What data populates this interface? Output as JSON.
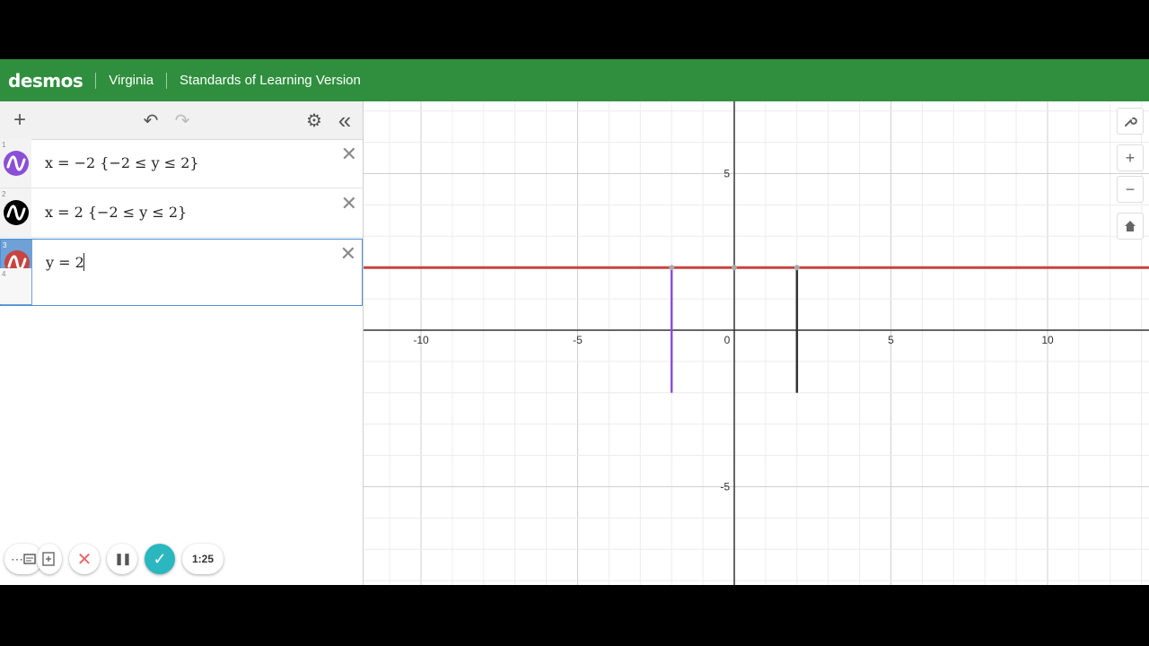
{
  "topbar": {
    "logo": "desmos",
    "region": "Virginia",
    "version": "Standards of Learning Version"
  },
  "toolbar": {
    "add_glyph": "+",
    "undo_glyph": "↶",
    "redo_glyph": "↷",
    "settings_glyph": "⚙",
    "collapse_glyph": "«"
  },
  "expressions": [
    {
      "index": "1",
      "latex": "x = −2 {−2 ≤ y ≤ 2}",
      "color": "#8a4fd6"
    },
    {
      "index": "2",
      "latex": "x = 2 {−2 ≤ y ≤ 2}",
      "color": "#000000"
    },
    {
      "index": "3",
      "latex": "y = 2",
      "color": "#c74440"
    }
  ],
  "empty_row_index": "4",
  "recorder": {
    "more_glyph": "⋯",
    "cancel_glyph": "✕",
    "pause_glyph": "❚❚",
    "done_glyph": "✓",
    "time": "1:25"
  },
  "graph": {
    "x_ticks": [
      "-10",
      "-5",
      "0",
      "5",
      "10"
    ],
    "y_ticks": [
      "5",
      "-5"
    ],
    "axis_color": "#333333",
    "line_colors": {
      "purple": "#8a4fd6",
      "black": "#333333",
      "red": "#c74440"
    }
  },
  "right_tools": {
    "wrench": "wrench-icon",
    "zoom_in": "+",
    "zoom_out": "−",
    "home": "home-icon"
  }
}
